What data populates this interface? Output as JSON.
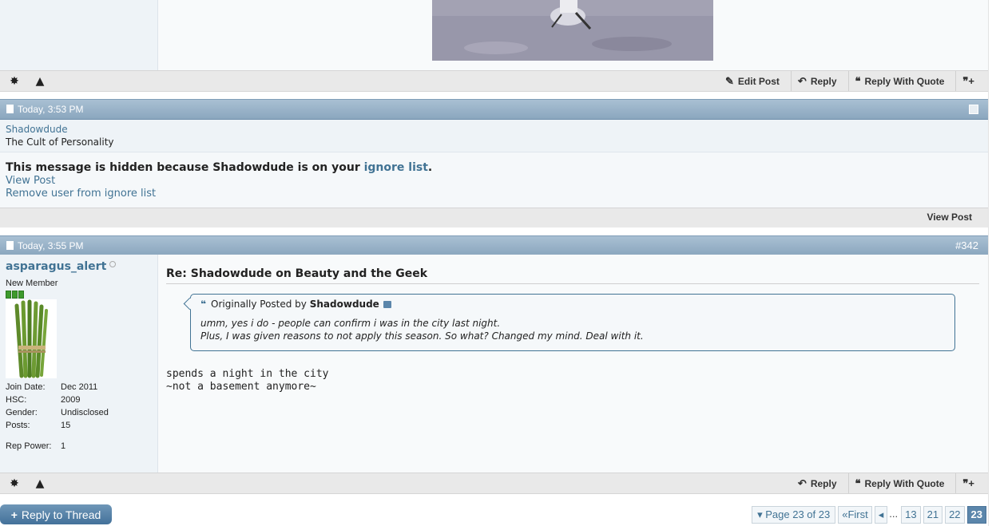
{
  "top_post": {
    "actions": [
      {
        "icon": "pencil-icon",
        "label": "Edit Post"
      },
      {
        "icon": "reply-icon",
        "label": "Reply"
      },
      {
        "icon": "quote-icon",
        "label": "Reply With Quote"
      }
    ]
  },
  "ignored_post": {
    "date": "Today, 3:53 PM",
    "username": "Shadowdude",
    "user_title": "The Cult of Personality",
    "hidden_msg_prefix": "This message is hidden because Shadowdude is on your ",
    "ignore_list_link": "ignore list",
    "hidden_msg_suffix": ".",
    "view_post_link": "View Post",
    "remove_link": "Remove user from ignore list",
    "view_post_button": "View Post"
  },
  "post": {
    "date": "Today, 3:55 PM",
    "number": "#342",
    "username": "asparagus_alert",
    "user_title": "New Member",
    "stats": [
      {
        "key": "Join Date:",
        "value": "Dec 2011"
      },
      {
        "key": "HSC:",
        "value": "2009"
      },
      {
        "key": "Gender:",
        "value": "Undisclosed"
      },
      {
        "key": "Posts:",
        "value": "15"
      }
    ],
    "rep_power_key": "Rep Power:",
    "rep_power_value": "1",
    "title": "Re: Shadowdude on Beauty and the Geek",
    "quote": {
      "prefix": "Originally Posted by",
      "author": "Shadowdude",
      "line1": "umm, yes i do - people can confirm i was in the city last night.",
      "line2": "Plus, I was given reasons to not apply this season. So what? Changed my mind. Deal with it."
    },
    "message_line1": "spends a night in the city",
    "message_line2": "~not a basement anymore~",
    "actions": [
      {
        "icon": "reply-icon",
        "label": "Reply"
      },
      {
        "icon": "quote-icon",
        "label": "Reply With Quote"
      }
    ]
  },
  "bottom": {
    "reply_thread": "Reply to Thread",
    "page_label": "Page 23 of 23",
    "first_label": "First",
    "dots": "...",
    "pages": [
      "13",
      "21",
      "22"
    ],
    "current_page": "23"
  },
  "colors": {
    "accent": "#417394",
    "header_bar": "#8aa6be",
    "rep_green": "#3d9a2c"
  }
}
